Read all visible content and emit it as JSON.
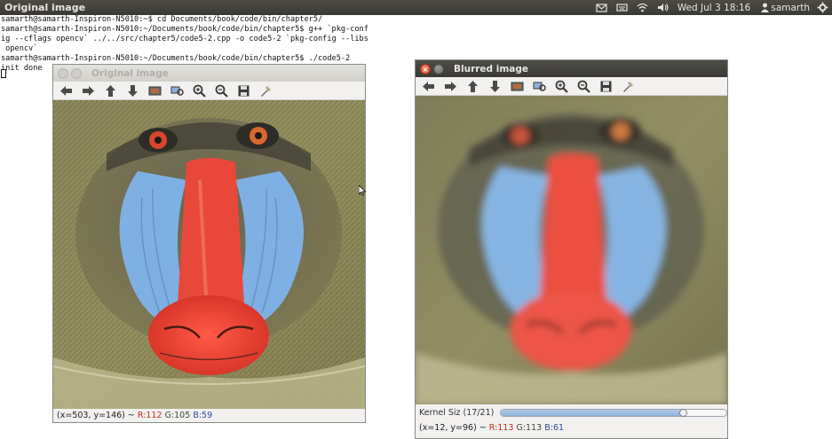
{
  "topbar": {
    "window_title": "Original image",
    "clock": "Wed Jul 3 18:16",
    "user": "samarth"
  },
  "terminal": {
    "lines": [
      "samarth@samarth-Inspiron-N5010:~$ cd Documents/book/code/bin/chapter5/",
      "samarth@samarth-Inspiron-N5010:~/Documents/book/code/bin/chapter5$ g++ `pkg-conf",
      "ig --cflags opencv` ../../src/chapter5/code5-2.cpp -o code5-2 `pkg-config --libs",
      " opencv`",
      "samarth@samarth-Inspiron-N5010:~/Documents/book/code/bin/chapter5$ ./code5-2",
      "init done"
    ]
  },
  "windows": {
    "original": {
      "title": "Original image",
      "status": {
        "coords": "(x=503, y=146) ~ ",
        "r_label": "R:",
        "r": "112",
        "g_label": "G:",
        "g": "105",
        "b_label": "B:",
        "b": "59"
      }
    },
    "blurred": {
      "title": "Blurred image",
      "trackbar": {
        "label": "Kernel Siz (17/21)",
        "value": 17,
        "max": 21
      },
      "status": {
        "coords": "(x=12, y=96) ~ ",
        "r_label": "R:",
        "r": "113",
        "g_label": "G:",
        "g": "113",
        "b_label": "B:",
        "b": "61"
      }
    }
  },
  "toolbar_icons": [
    "pan-left-icon",
    "pan-right-icon",
    "pan-up-icon",
    "pan-down-icon",
    "zoom-fit-icon",
    "zoom-reset-icon",
    "zoom-in-icon",
    "zoom-out-icon",
    "save-icon",
    "properties-icon"
  ],
  "colors": {
    "panel": "#3c3b37",
    "nose_red": "#e8483a",
    "cheek_blue": "#7fb0e3",
    "fur_olive": "#8a7a3c"
  }
}
